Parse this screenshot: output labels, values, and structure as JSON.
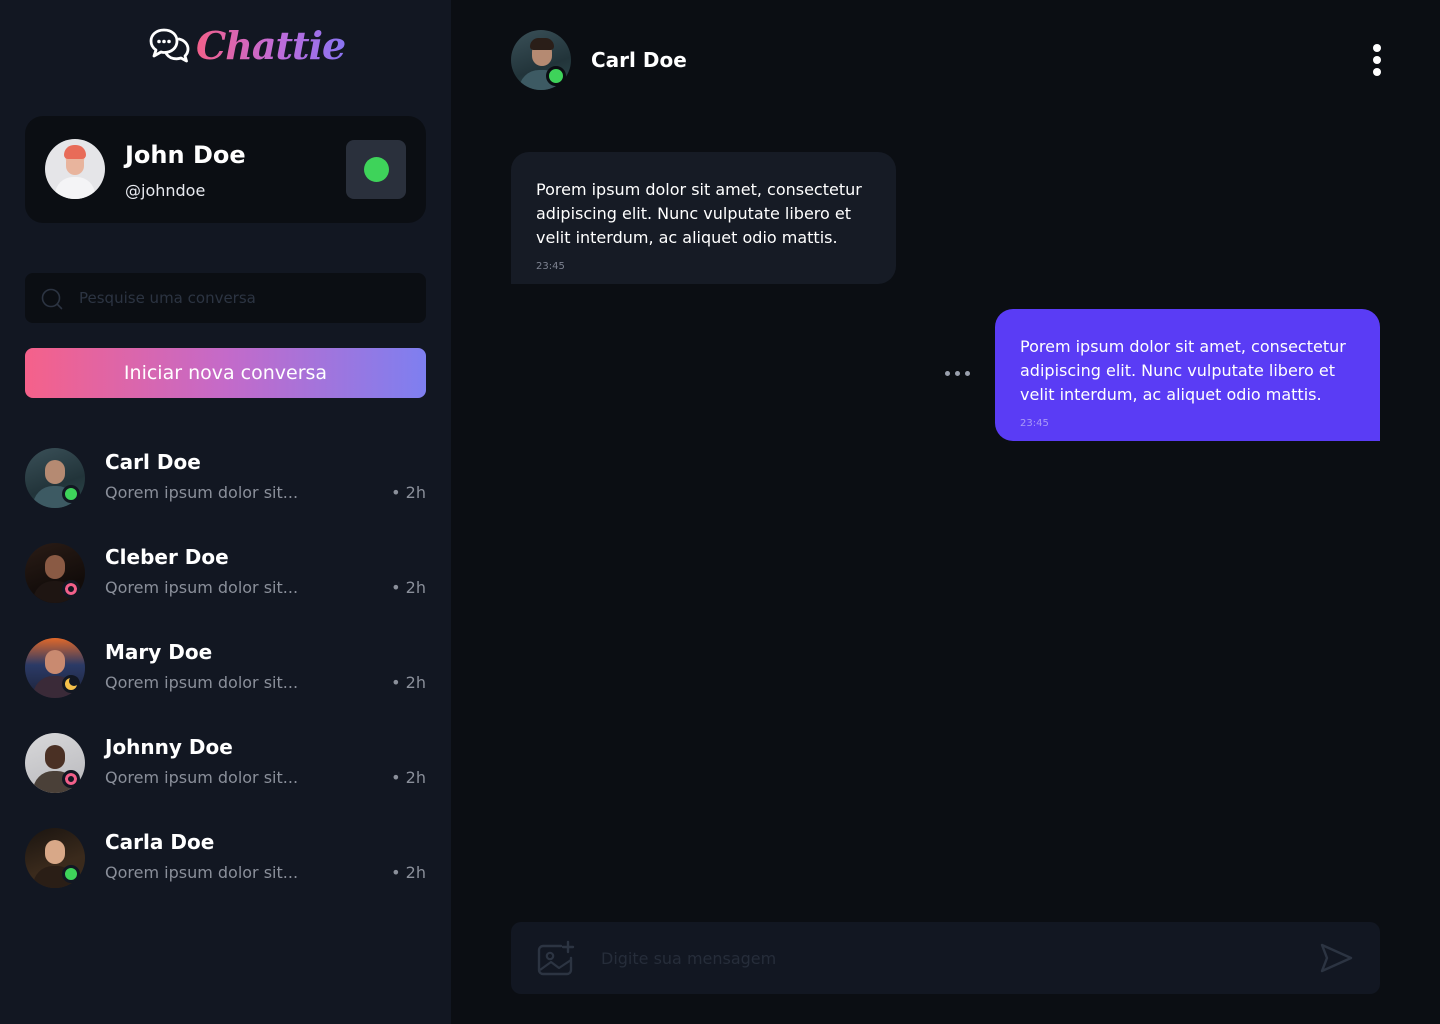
{
  "brand": {
    "name": "Chattie",
    "logo_icon": "chat-bubbles-icon"
  },
  "colors": {
    "gradient_start": "#f5618a",
    "gradient_end": "#7e7ff0",
    "online": "#3ed35a",
    "offline": "#f2608a",
    "away": "#f5c04a",
    "sent_bubble": "#5a3cf5"
  },
  "profile": {
    "name": "John Doe",
    "handle": "@johndoe",
    "status": "online"
  },
  "search": {
    "placeholder": "Pesquise uma conversa",
    "value": ""
  },
  "new_chat_button": "Iniciar nova conversa",
  "contacts": [
    {
      "name": "Carl Doe",
      "preview": "Qorem ipsum dolor sit...",
      "time": "• 2h",
      "status": "online"
    },
    {
      "name": "Cleber Doe",
      "preview": "Qorem ipsum dolor sit...",
      "time": "• 2h",
      "status": "offline"
    },
    {
      "name": "Mary Doe",
      "preview": "Qorem ipsum dolor sit...",
      "time": "• 2h",
      "status": "away"
    },
    {
      "name": "Johnny Doe",
      "preview": "Qorem ipsum dolor sit...",
      "time": "• 2h",
      "status": "offline"
    },
    {
      "name": "Carla Doe",
      "preview": "Qorem ipsum dolor sit...",
      "time": "• 2h",
      "status": "online"
    }
  ],
  "chat": {
    "contact_name": "Carl Doe",
    "contact_status": "online",
    "messages": [
      {
        "direction": "received",
        "text": "Porem ipsum dolor sit amet, consectetur adipiscing elit. Nunc vulputate libero et velit interdum, ac aliquet odio mattis.",
        "time": "23:45"
      },
      {
        "direction": "sent",
        "text": "Porem ipsum dolor sit amet, consectetur adipiscing elit. Nunc vulputate libero et velit interdum, ac aliquet odio mattis.",
        "time": "23:45"
      }
    ],
    "composer": {
      "placeholder": "Digite sua mensagem",
      "value": ""
    }
  }
}
